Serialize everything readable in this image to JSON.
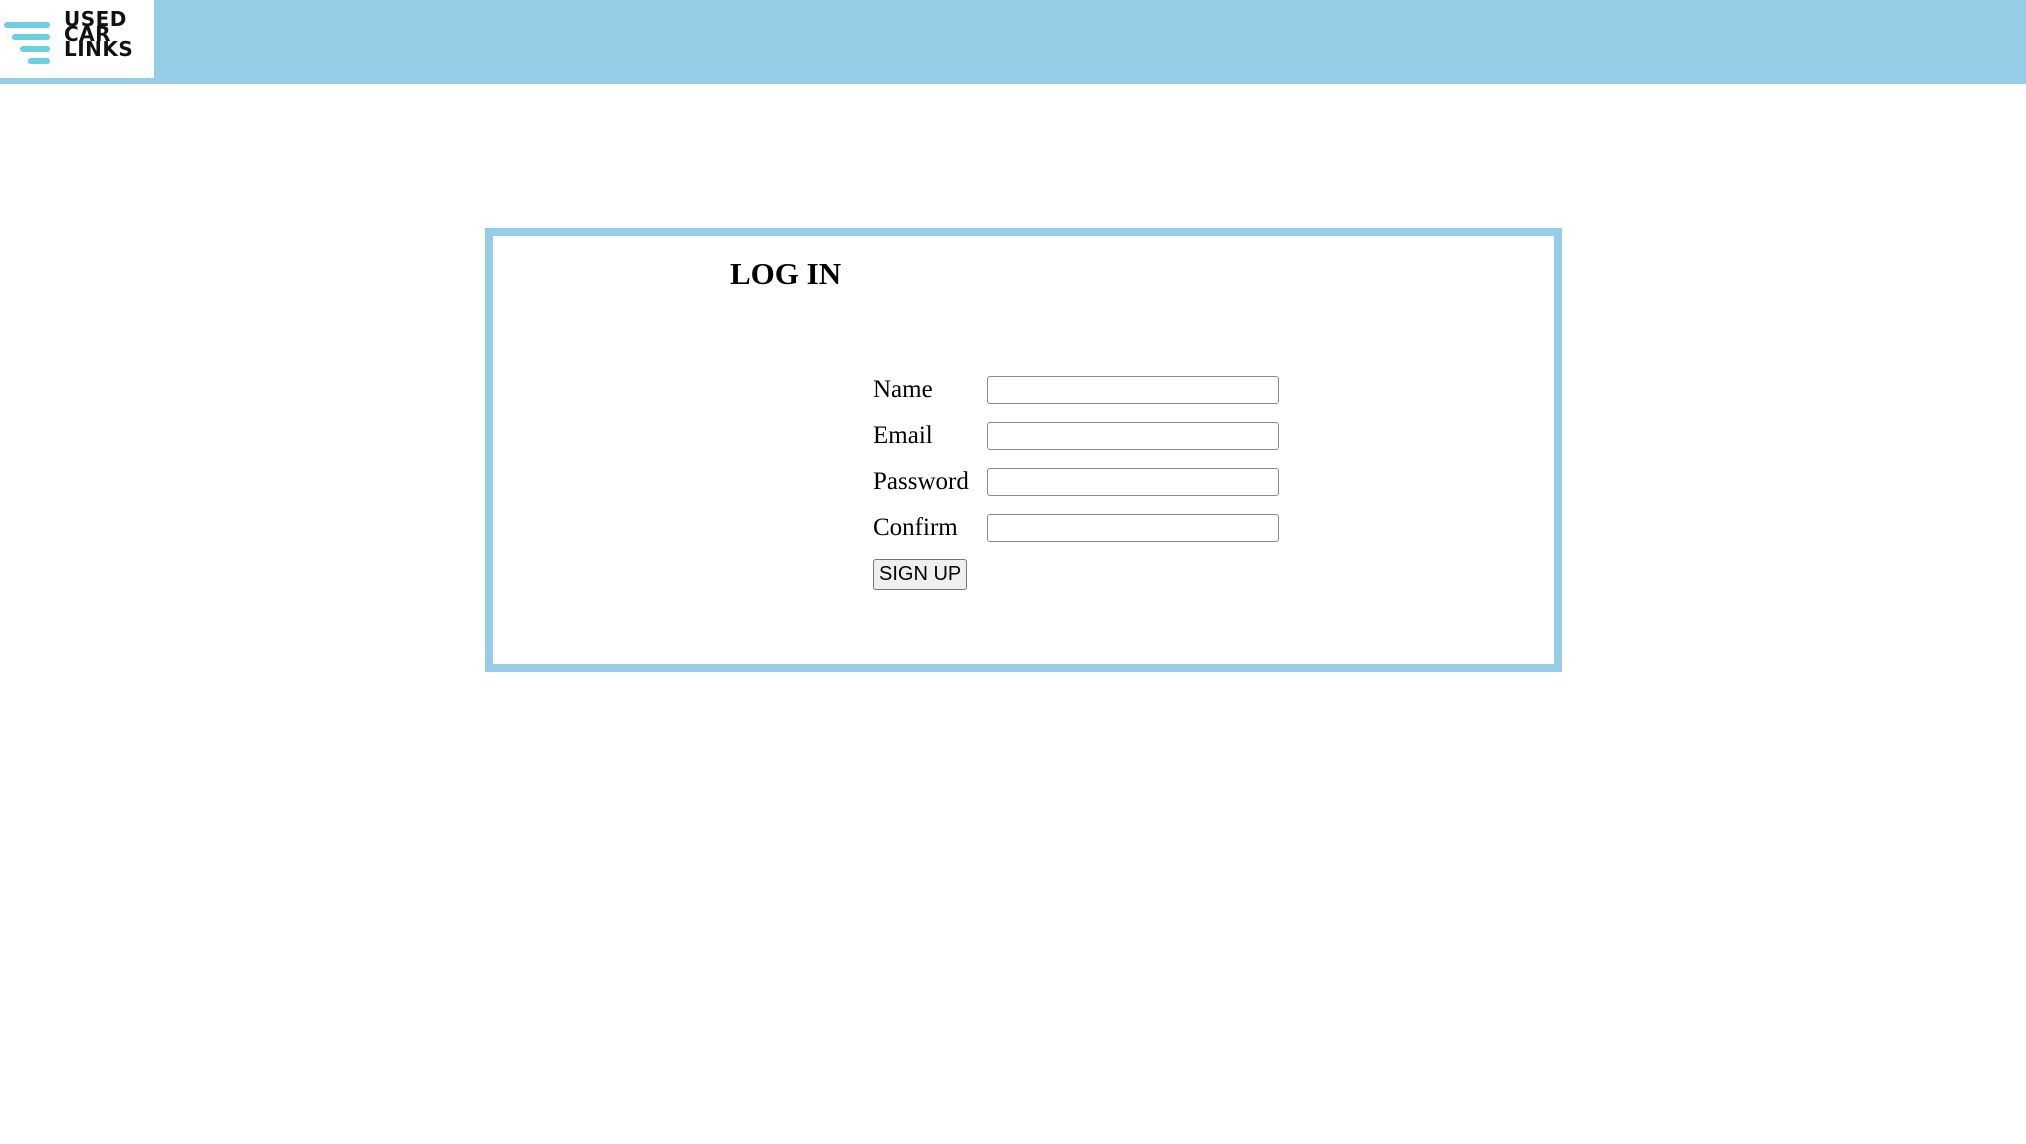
{
  "header": {
    "logo": {
      "lines": [
        "USED",
        "CAR",
        "LINKS"
      ],
      "icon": "stacked-bars-icon",
      "accent_color": "#6ccfe0"
    },
    "bar_color": "#97cce7"
  },
  "login_panel": {
    "title": "LOG IN",
    "border_color": "#97cce7",
    "fields": [
      {
        "label": "Name",
        "value": ""
      },
      {
        "label": "Email",
        "value": ""
      },
      {
        "label": "Password",
        "value": ""
      },
      {
        "label": "Confirm",
        "value": ""
      }
    ],
    "submit_label": "SIGN UP"
  }
}
